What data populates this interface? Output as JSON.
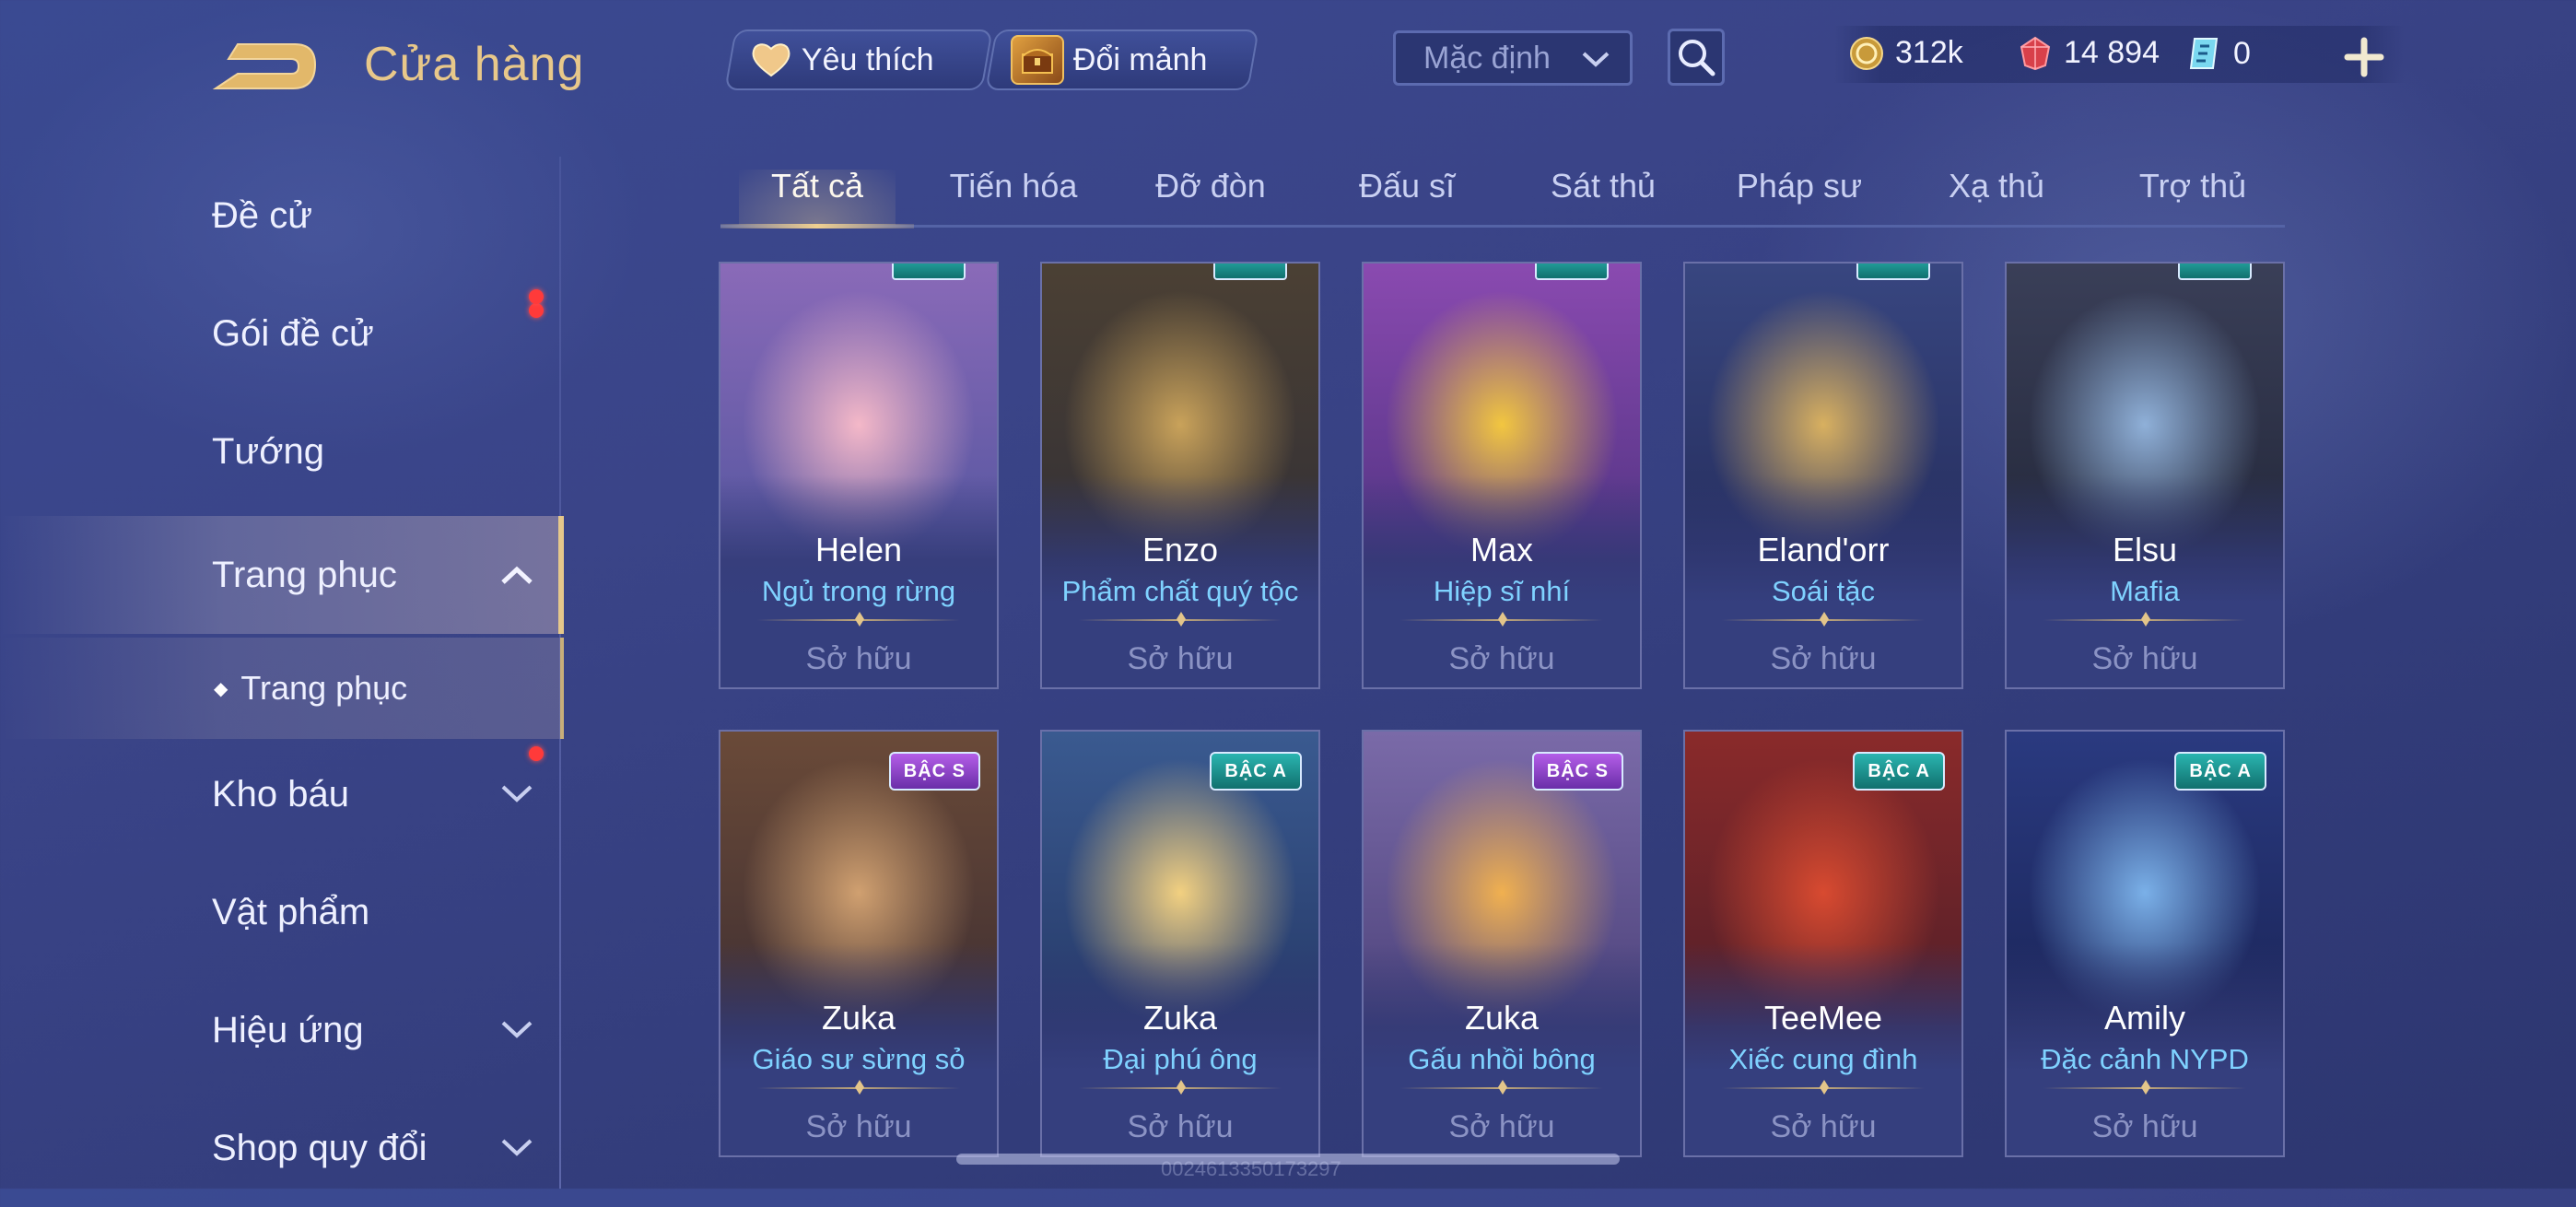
{
  "header": {
    "title": "Cửa hàng",
    "favorites_label": "Yêu thích",
    "shard_exchange_label": "Đổi mảnh",
    "sort_selected": "Mặc định",
    "currencies": {
      "gold": "312k",
      "gems": "14 894",
      "vouchers": "0"
    },
    "plus_label": "+"
  },
  "sidebar": {
    "items": [
      {
        "label": "Đề cử"
      },
      {
        "label": "Gói đề cử"
      },
      {
        "label": "Tướng"
      },
      {
        "label": "Trang phục"
      },
      {
        "label": "Trang phục"
      },
      {
        "label": "Kho báu"
      },
      {
        "label": "Vật phẩm"
      },
      {
        "label": "Hiệu ứng"
      },
      {
        "label": "Shop quy đổi"
      }
    ]
  },
  "tabs": [
    {
      "label": "Tất cả"
    },
    {
      "label": "Tiến hóa"
    },
    {
      "label": "Đỡ đòn"
    },
    {
      "label": "Đấu sĩ"
    },
    {
      "label": "Sát thủ"
    },
    {
      "label": "Pháp sư"
    },
    {
      "label": "Xạ thủ"
    },
    {
      "label": "Trợ thủ"
    }
  ],
  "cards": [
    {
      "hero": "Helen",
      "skin": "Ngủ trong rừng",
      "status": "Sở hữu",
      "tier": "",
      "art": [
        "#f4b8c8",
        "#8a6ab8",
        "#3e4d95"
      ]
    },
    {
      "hero": "Enzo",
      "skin": "Phẩm chất quý tộc",
      "status": "Sở hữu",
      "tier": "",
      "art": [
        "#c9a25a",
        "#4b4034",
        "#2a2a36"
      ]
    },
    {
      "hero": "Max",
      "skin": "Hiệp sĩ nhí",
      "status": "Sở hữu",
      "tier": "",
      "art": [
        "#f2c640",
        "#8a4ab0",
        "#3a2a70"
      ]
    },
    {
      "hero": "Eland'orr",
      "skin": "Soái tặc",
      "status": "Sở hữu",
      "tier": "",
      "art": [
        "#d8b060",
        "#384680",
        "#1e2450"
      ]
    },
    {
      "hero": "Elsu",
      "skin": "Mafia",
      "status": "Sở hữu",
      "tier": "",
      "art": [
        "#8fb0d8",
        "#3a3f58",
        "#1a1e2e"
      ]
    },
    {
      "hero": "Zuka",
      "skin": "Giáo sư sừng sỏ",
      "status": "Sở hữu",
      "tier": "BẬC S",
      "art": [
        "#d0a070",
        "#6a4a38",
        "#2e2430"
      ]
    },
    {
      "hero": "Zuka",
      "skin": "Đại phú ông",
      "status": "Sở hữu",
      "tier": "BẬC A",
      "art": [
        "#f2d080",
        "#3a5a90",
        "#1e2c58"
      ]
    },
    {
      "hero": "Zuka",
      "skin": "Gấu nhồi bông",
      "status": "Sở hữu",
      "tier": "BẬC S",
      "art": [
        "#f0b050",
        "#7a6aa8",
        "#3a3268"
      ]
    },
    {
      "hero": "TeeMee",
      "skin": "Xiếc cung đình",
      "status": "Sở hữu",
      "tier": "BẬC A",
      "art": [
        "#d84a30",
        "#8a2a2a",
        "#3a1a28"
      ]
    },
    {
      "hero": "Amily",
      "skin": "Đặc cảnh NYPD",
      "status": "Sở hữu",
      "tier": "BẬC A",
      "art": [
        "#7ab0e8",
        "#2a3a80",
        "#141c48"
      ]
    }
  ],
  "colors": {
    "accent_gold": "#e8c88a",
    "skin_name": "#7fd2ff",
    "notification": "#ff3a3a",
    "tier_s": "#b45ee8",
    "tier_a": "#2ab5b0"
  },
  "watermark": "0024613350173297"
}
